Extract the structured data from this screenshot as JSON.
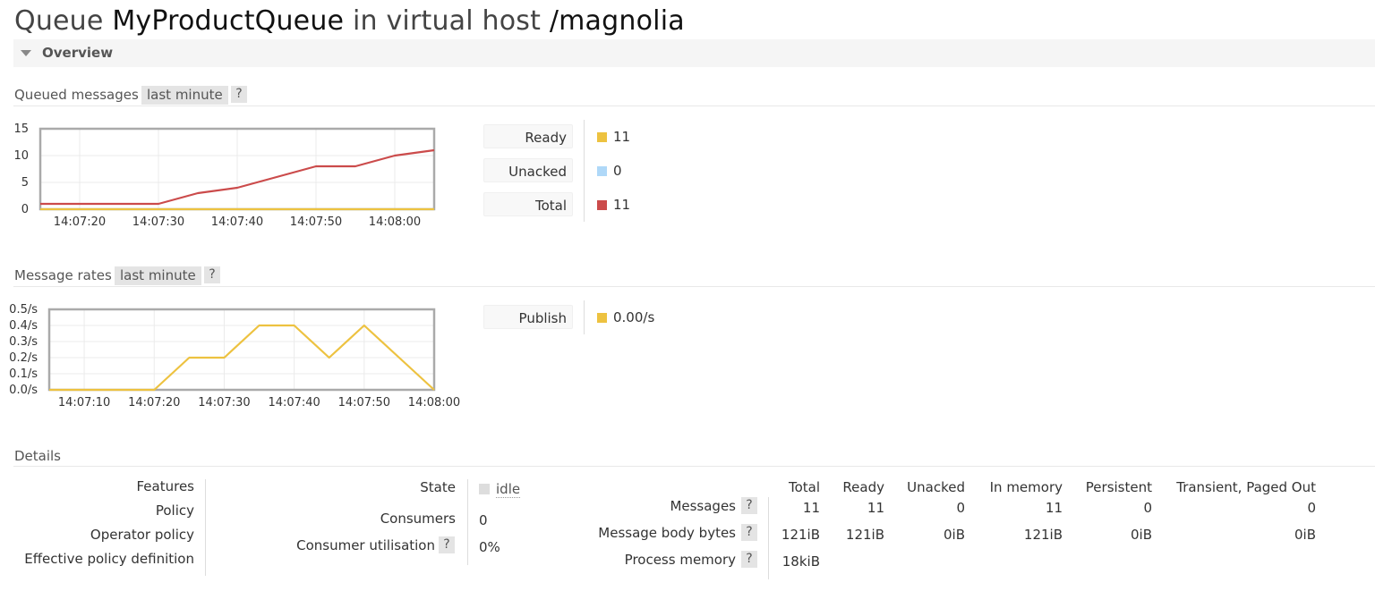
{
  "header": {
    "prefix": "Queue",
    "queue_name": "MyProductQueue",
    "middle": "in virtual host",
    "vhost": "/magnolia"
  },
  "overview": {
    "title": "Overview"
  },
  "queued": {
    "heading": "Queued messages",
    "range": "last minute",
    "help": "?",
    "legend": [
      {
        "label": "Ready",
        "value": "11",
        "color": "#edc240"
      },
      {
        "label": "Unacked",
        "value": "0",
        "color": "#afd8f8"
      },
      {
        "label": "Total",
        "value": "11",
        "color": "#cb4b4b"
      }
    ]
  },
  "rates": {
    "heading": "Message rates",
    "range": "last minute",
    "help": "?",
    "legend": [
      {
        "label": "Publish",
        "value": "0.00/s",
        "color": "#edc240"
      }
    ]
  },
  "details": {
    "heading": "Details",
    "left_labels": [
      "Features",
      "Policy",
      "Operator policy",
      "Effective policy definition"
    ],
    "state_label": "State",
    "state_value": "idle",
    "consumers_label": "Consumers",
    "consumers_value": "0",
    "utilisation_label": "Consumer utilisation",
    "utilisation_help": "?",
    "utilisation_value": "0%",
    "table": {
      "headers": [
        "Total",
        "Ready",
        "Unacked",
        "In memory",
        "Persistent",
        "Transient, Paged Out"
      ],
      "rows": [
        {
          "label": "Messages",
          "help": "?",
          "cells": [
            "11",
            "11",
            "0",
            "11",
            "0",
            "0"
          ]
        },
        {
          "label": "Message body bytes",
          "help": "?",
          "cells": [
            "121iB",
            "121iB",
            "0iB",
            "121iB",
            "0iB",
            "0iB"
          ]
        },
        {
          "label": "Process memory",
          "help": "?",
          "cells": [
            "18kiB"
          ]
        }
      ]
    }
  },
  "chart_data": [
    {
      "type": "line",
      "title": "",
      "xlabel": "",
      "ylabel": "",
      "x": [
        "14:07:15",
        "14:07:20",
        "14:07:25",
        "14:07:30",
        "14:07:35",
        "14:07:40",
        "14:07:45",
        "14:07:50",
        "14:07:55",
        "14:08:00",
        "14:08:05"
      ],
      "xticks": [
        "14:07:20",
        "14:07:30",
        "14:07:40",
        "14:07:50",
        "14:08:00"
      ],
      "yticks": [
        "0",
        "5",
        "10",
        "15"
      ],
      "ylim": [
        0,
        15
      ],
      "grid": true,
      "series": [
        {
          "name": "Ready",
          "color": "#edc240",
          "values": [
            0,
            0,
            0,
            0,
            0,
            0,
            0,
            0,
            0,
            0,
            0
          ]
        },
        {
          "name": "Unacked",
          "color": "#afd8f8",
          "values": [
            0,
            0,
            0,
            0,
            0,
            0,
            0,
            0,
            0,
            0,
            0
          ]
        },
        {
          "name": "Total",
          "color": "#cb4b4b",
          "values": [
            1,
            1,
            1,
            1,
            3,
            4,
            6,
            8,
            8,
            10,
            11
          ]
        }
      ]
    },
    {
      "type": "line",
      "title": "",
      "xlabel": "",
      "ylabel": "",
      "x": [
        "14:07:05",
        "14:07:10",
        "14:07:15",
        "14:07:20",
        "14:07:25",
        "14:07:30",
        "14:07:35",
        "14:07:40",
        "14:07:45",
        "14:07:50",
        "14:07:55",
        "14:08:00"
      ],
      "xticks": [
        "14:07:10",
        "14:07:20",
        "14:07:30",
        "14:07:40",
        "14:07:50",
        "14:08:00"
      ],
      "yticks": [
        "0.0/s",
        "0.1/s",
        "0.2/s",
        "0.3/s",
        "0.4/s",
        "0.5/s"
      ],
      "ylim": [
        0,
        0.5
      ],
      "grid": true,
      "series": [
        {
          "name": "Publish",
          "color": "#edc240",
          "values": [
            0,
            0,
            0,
            0,
            0.2,
            0.2,
            0.4,
            0.4,
            0.2,
            0.4,
            0.2,
            0
          ]
        }
      ]
    }
  ]
}
